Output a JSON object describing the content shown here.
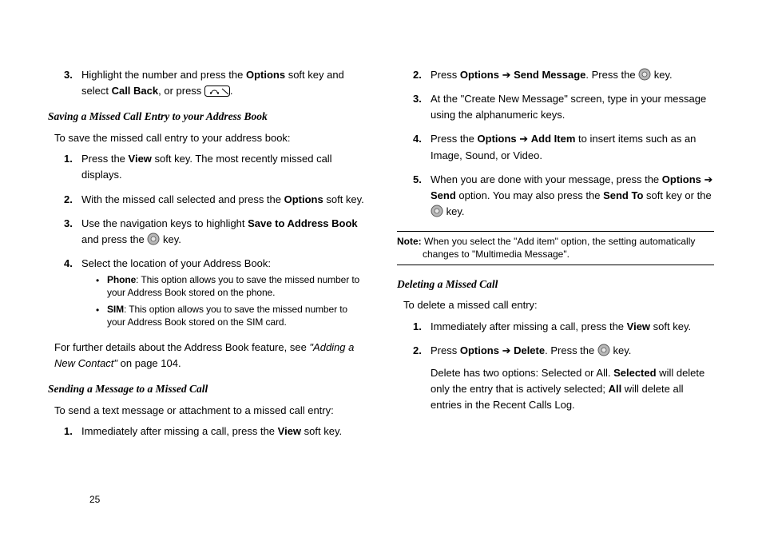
{
  "page_number": "25",
  "left": {
    "step3_a": "Highlight the number and press the ",
    "step3_b": "Options",
    "step3_c": " soft key and select ",
    "step3_d": "Call Back",
    "step3_e": ", or press ",
    "step3_f": ".",
    "h1": "Saving a Missed Call Entry to your Address Book",
    "intro1": "To save the missed call entry to your address book:",
    "s1_a": "Press the ",
    "s1_b": "View",
    "s1_c": " soft key. The most recently missed call displays.",
    "s2_a": "With the missed call selected and press the ",
    "s2_b": "Options",
    "s2_c": " soft key.",
    "s3_a": "Use the navigation keys to highlight ",
    "s3_b": "Save to Address Book",
    "s3_c": " and press the ",
    "s3_d": " key.",
    "s4": "Select the location of your Address Book:",
    "b1_a": "Phone",
    "b1_b": ": This option allows you to save the missed number to your Address Book stored on the phone.",
    "b2_a": "SIM",
    "b2_b": ": This option allows you to save the missed number to your Address Book stored on the SIM card.",
    "p1_a": "For further details about the Address Book feature, see ",
    "p1_b": "\"Adding a New Contact\"",
    "p1_c": " on page 104.",
    "h2": "Sending a Message to a Missed Call",
    "intro2": "To send a text message or attachment to a missed call entry:",
    "m1_a": "Immediately after missing a call, press the ",
    "m1_b": "View",
    "m1_c": " soft key."
  },
  "right": {
    "r2_a": "Press ",
    "r2_b": "Options",
    "r2_c": " ➔ ",
    "r2_d": "Send Message",
    "r2_e": ". Press the ",
    "r2_f": " key.",
    "r3": "At the \"Create New Message\" screen, type in your message using the alphanumeric keys.",
    "r4_a": "Press the ",
    "r4_b": "Options",
    "r4_c": " ➔ ",
    "r4_d": "Add Item",
    "r4_e": " to insert items such as an Image, Sound, or Video.",
    "r5_a": "When you are done with your message, press the ",
    "r5_b": "Options",
    "r5_c": " ➔ ",
    "r5_d": "Send",
    "r5_e": " option. You may also press the ",
    "r5_f": "Send To",
    "r5_g": " soft key or the ",
    "r5_h": " key.",
    "note_a": "Note:",
    "note_b": " When you select the \"Add item\" option, the setting automatically changes to \"Multimedia Message\".",
    "h3": "Deleting a Missed Call",
    "intro3": "To delete a missed call entry:",
    "d1_a": "Immediately after missing a call, press the ",
    "d1_b": "View",
    "d1_c": " soft key.",
    "d2_a": "Press ",
    "d2_b": "Options",
    "d2_c": " ➔ ",
    "d2_d": "Delete",
    "d2_e": ". Press the ",
    "d2_f": " key.",
    "d_para_a": "Delete has two options: Selected or All. ",
    "d_para_b": "Selected",
    "d_para_c": " will delete only the entry that is actively selected; ",
    "d_para_d": "All",
    "d_para_e": " will delete all entries in the Recent Calls Log."
  }
}
